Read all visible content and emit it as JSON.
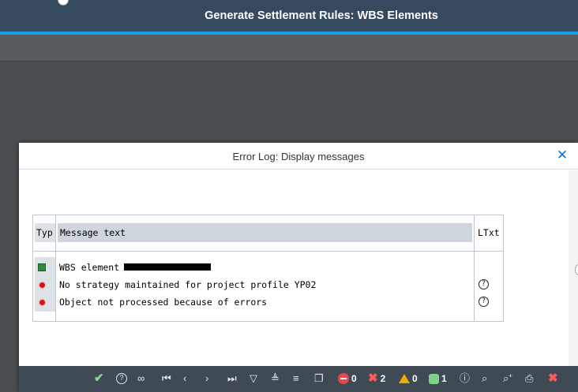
{
  "shell": {
    "title": "Generate Settlement Rules: WBS Elements"
  },
  "dialog": {
    "title": "Error Log: Display messages",
    "close_icon": "close-icon",
    "grid": {
      "columns": [
        "Typ",
        "Message text",
        "LTxt"
      ],
      "rows": [
        {
          "type": "success",
          "text": "WBS element",
          "redacted": true,
          "ltxt": ""
        },
        {
          "type": "error",
          "text": "No strategy maintained for project profile YP02",
          "redacted": false,
          "ltxt": "?"
        },
        {
          "type": "error",
          "text": "Object not processed because of errors",
          "redacted": false,
          "ltxt": "?"
        }
      ]
    },
    "footer": {
      "errors_count": "0",
      "aborts_count": "2",
      "warnings_count": "0",
      "info_count": "1"
    }
  },
  "colors": {
    "shell_bg": "#354a5f",
    "accent": "#1a9fe0",
    "success": "#2a8a3e",
    "error": "#d0121a",
    "warning": "#f0ab00"
  }
}
